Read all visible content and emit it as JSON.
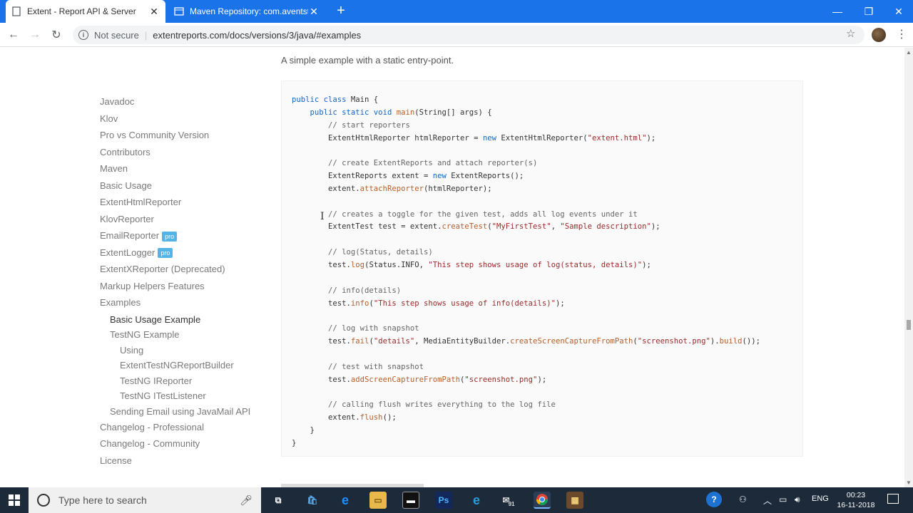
{
  "tabs": [
    {
      "title": "Extent - Report API & Server",
      "active": true
    },
    {
      "title": "Maven Repository: com.aventstack",
      "active": false
    }
  ],
  "omnibox": {
    "security": "Not secure",
    "url": "extentreports.com/docs/versions/3/java/#examples"
  },
  "intro": "A simple example with a static entry-point.",
  "nav": [
    {
      "label": "Javadoc",
      "level": 1
    },
    {
      "label": "Klov",
      "level": 1
    },
    {
      "label": "Pro vs Community Version",
      "level": 1
    },
    {
      "label": "Contributors",
      "level": 1
    },
    {
      "label": "Maven",
      "level": 1
    },
    {
      "label": "Basic Usage",
      "level": 1
    },
    {
      "label": "ExtentHtmlReporter",
      "level": 1
    },
    {
      "label": "KlovReporter",
      "level": 1
    },
    {
      "label": "EmailReporter",
      "level": 1,
      "badge": "pro"
    },
    {
      "label": "ExtentLogger",
      "level": 1,
      "badge": "pro"
    },
    {
      "label": "ExtentXReporter (Deprecated)",
      "level": 1
    },
    {
      "label": "Markup Helpers Features",
      "level": 1
    },
    {
      "label": "Examples",
      "level": 1
    },
    {
      "label": "Basic Usage Example",
      "level": 2,
      "active": true
    },
    {
      "label": "TestNG Example",
      "level": 2
    },
    {
      "label": "Using",
      "level": 3
    },
    {
      "label": "ExtentTestNGReportBuilder",
      "level": 3
    },
    {
      "label": "TestNG IReporter",
      "level": 3
    },
    {
      "label": "TestNG ITestListener",
      "level": 3
    },
    {
      "label": "Sending Email using JavaMail API",
      "level": 2
    },
    {
      "label": "Changelog - Professional",
      "level": 1
    },
    {
      "label": "Changelog - Community",
      "level": 1
    },
    {
      "label": "License",
      "level": 1
    }
  ],
  "code_lines": [
    [
      [
        "kw",
        "public class "
      ],
      [
        "",
        "Main {"
      ]
    ],
    [
      [
        "",
        "    "
      ],
      [
        "kw",
        "public static void "
      ],
      [
        "fn",
        "main"
      ],
      [
        "",
        "(String[] args) {"
      ]
    ],
    [
      [
        "cm",
        "        // start reporters"
      ]
    ],
    [
      [
        "",
        "        ExtentHtmlReporter htmlReporter = "
      ],
      [
        "kw",
        "new "
      ],
      [
        "",
        "ExtentHtmlReporter("
      ],
      [
        "st",
        "\"extent.html\""
      ],
      [
        "",
        ");"
      ]
    ],
    [
      [
        "",
        ""
      ]
    ],
    [
      [
        "cm",
        "        // create ExtentReports and attach reporter(s)"
      ]
    ],
    [
      [
        "",
        "        ExtentReports extent = "
      ],
      [
        "kw",
        "new "
      ],
      [
        "",
        "ExtentReports();"
      ]
    ],
    [
      [
        "",
        "        extent."
      ],
      [
        "fn",
        "attachReporter"
      ],
      [
        "",
        "(htmlReporter);"
      ]
    ],
    [
      [
        "",
        ""
      ]
    ],
    [
      [
        "cm",
        "        // creates a toggle for the given test, adds all log events under it"
      ]
    ],
    [
      [
        "",
        "        ExtentTest test = extent."
      ],
      [
        "fn",
        "createTest"
      ],
      [
        "",
        "("
      ],
      [
        "st",
        "\"MyFirstTest\""
      ],
      [
        "",
        ", "
      ],
      [
        "st",
        "\"Sample description\""
      ],
      [
        "",
        ");"
      ]
    ],
    [
      [
        "",
        ""
      ]
    ],
    [
      [
        "cm",
        "        // log(Status, details)"
      ]
    ],
    [
      [
        "",
        "        test."
      ],
      [
        "fn",
        "log"
      ],
      [
        "",
        "(Status.INFO, "
      ],
      [
        "st",
        "\"This step shows usage of log(status, details)\""
      ],
      [
        "",
        ");"
      ]
    ],
    [
      [
        "",
        ""
      ]
    ],
    [
      [
        "cm",
        "        // info(details)"
      ]
    ],
    [
      [
        "",
        "        test."
      ],
      [
        "fn",
        "info"
      ],
      [
        "",
        "("
      ],
      [
        "st",
        "\"This step shows usage of info(details)\""
      ],
      [
        "",
        ");"
      ]
    ],
    [
      [
        "",
        ""
      ]
    ],
    [
      [
        "cm",
        "        // log with snapshot"
      ]
    ],
    [
      [
        "",
        "        test."
      ],
      [
        "fn",
        "fail"
      ],
      [
        "",
        "("
      ],
      [
        "st",
        "\"details\""
      ],
      [
        "",
        ", MediaEntityBuilder."
      ],
      [
        "fn",
        "createScreenCaptureFromPath"
      ],
      [
        "",
        "("
      ],
      [
        "st",
        "\"screenshot.png\""
      ],
      [
        "",
        ")."
      ],
      [
        "fn",
        "build"
      ],
      [
        "",
        "());"
      ]
    ],
    [
      [
        "",
        ""
      ]
    ],
    [
      [
        "cm",
        "        // test with snapshot"
      ]
    ],
    [
      [
        "",
        "        test."
      ],
      [
        "fn",
        "addScreenCaptureFromPath"
      ],
      [
        "",
        "("
      ],
      [
        "st",
        "\"screenshot.png\""
      ],
      [
        "",
        ");"
      ]
    ],
    [
      [
        "",
        ""
      ]
    ],
    [
      [
        "cm",
        "        // calling flush writes everything to the log file"
      ]
    ],
    [
      [
        "",
        "        extent."
      ],
      [
        "fn",
        "flush"
      ],
      [
        "",
        "();"
      ]
    ],
    [
      [
        "",
        "    }"
      ]
    ],
    [
      [
        "",
        "}"
      ]
    ]
  ],
  "taskbar": {
    "search_placeholder": "Type here to search",
    "mail_badge": "91",
    "language": "ENG",
    "time": "00:23",
    "date": "16-11-2018"
  },
  "colors": {
    "chrome_blue": "#1a73e8",
    "taskbar": "#1c2a3a",
    "pro_badge": "#54b4e8"
  }
}
